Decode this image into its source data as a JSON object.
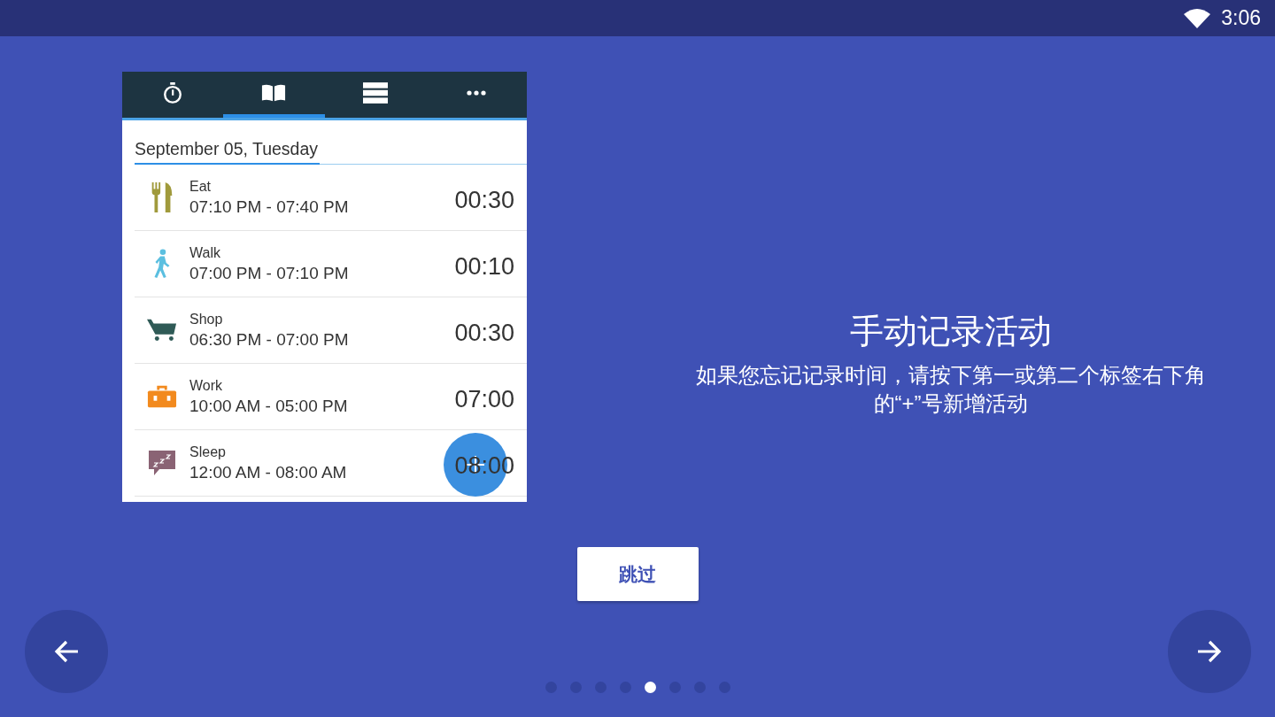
{
  "status_bar": {
    "time": "3:06"
  },
  "app_screenshot": {
    "tabs": [
      {
        "kind": "stopwatch",
        "selected": false
      },
      {
        "kind": "book",
        "selected": true
      },
      {
        "kind": "list",
        "selected": false
      },
      {
        "kind": "more",
        "selected": false
      }
    ],
    "date_header": "September 05, Tuesday",
    "entries": [
      {
        "kind": "eat",
        "name": "Eat",
        "time_range": "07:10 PM - 07:40 PM",
        "duration": "00:30"
      },
      {
        "kind": "walk",
        "name": "Walk",
        "time_range": "07:00 PM - 07:10 PM",
        "duration": "00:10"
      },
      {
        "kind": "shop",
        "name": "Shop",
        "time_range": "06:30 PM - 07:00 PM",
        "duration": "00:30"
      },
      {
        "kind": "work",
        "name": "Work",
        "time_range": "10:00 AM - 05:00 PM",
        "duration": "07:00"
      },
      {
        "kind": "sleep",
        "name": "Sleep",
        "time_range": "12:00 AM - 08:00 AM",
        "duration": "08:00"
      }
    ]
  },
  "intro": {
    "title": "手动记录活动",
    "description": "如果您忘记记录时间，请按下第一或第二个标签右下角的“+”号新增活动"
  },
  "skip_button": "跳过",
  "pager": [
    {
      "selected": false
    },
    {
      "selected": false
    },
    {
      "selected": false
    },
    {
      "selected": false
    },
    {
      "selected": true
    },
    {
      "selected": false
    },
    {
      "selected": false
    },
    {
      "selected": false
    }
  ]
}
